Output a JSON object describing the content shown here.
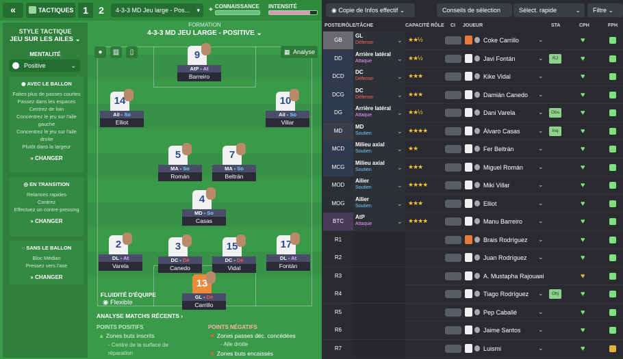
{
  "topbar": {
    "back": "«",
    "tab": "TACTIQUES",
    "n1": "1",
    "n2": "2",
    "formation": "4-3-3 MD Jeu large - Pos...",
    "connaissance": "CONNAISSANCE",
    "intensite": "INTENSITÉ",
    "plus": "+",
    "minus": "-"
  },
  "side": {
    "style_lbl": "STYLE TACTIQUE",
    "style": "JEU SUR LES AILES",
    "mentalite_lbl": "MENTALITÉ",
    "mentalite": "Positive",
    "ballon": {
      "title": "AVEC LE BALLON",
      "lines": [
        "Faites plus de passes courtes",
        "Passez dans les espaces",
        "Centrez de loin",
        "Concentrez le jeu sur l'aile gauche",
        "Concentrez le jeu sur l'aile droite",
        "Plutôt dans la largeur"
      ],
      "change": "CHANGER"
    },
    "transition": {
      "title": "EN TRANSITION",
      "lines": [
        "Relances rapides",
        "Contrez",
        "Effectuez un contre-pressing"
      ],
      "change": "CHANGER"
    },
    "sans": {
      "title": "SANS LE BALLON",
      "lines": [
        "Bloc Médian",
        "Pressez vers l'axe"
      ],
      "change": "CHANGER"
    }
  },
  "pitch": {
    "formation_lbl": "FORMATION",
    "formation": "4-3-3 MD JEU LARGE - POSITIVE",
    "analyse": "Analyse",
    "fluidite_lbl": "FLUIDITÉ D'ÉQUIPE",
    "fluidite": "Flexible",
    "analyse_matchs": "ANALYSE MATCHS RÉCENTS",
    "positifs_lbl": "POINTS POSITIFS",
    "positifs": [
      "Zones buts inscrits",
      "- Centre de la surface de réparation"
    ],
    "negatifs_lbl": "POINTS NÉGATIFS",
    "negatifs": [
      "Zones passes déc. concédées",
      "- Aile droite",
      "Zones buts encaissés"
    ],
    "players": [
      {
        "n": "9",
        "role": "AtP - ",
        "duty": "At",
        "dc": "a",
        "name": "Barreiro"
      },
      {
        "n": "14",
        "role": "AiI - ",
        "duty": "So",
        "dc": "s",
        "name": "Elliot"
      },
      {
        "n": "10",
        "role": "AiI - ",
        "duty": "So",
        "dc": "s",
        "name": "Villar"
      },
      {
        "n": "5",
        "role": "MA - ",
        "duty": "So",
        "dc": "s",
        "name": "Román"
      },
      {
        "n": "7",
        "role": "MA - ",
        "duty": "So",
        "dc": "s",
        "name": "Beltrán"
      },
      {
        "n": "4",
        "role": "MD - ",
        "duty": "So",
        "dc": "s",
        "name": "Casas"
      },
      {
        "n": "2",
        "role": "DL - ",
        "duty": "At",
        "dc": "a",
        "name": "Varela"
      },
      {
        "n": "3",
        "role": "DC - ",
        "duty": "Dé",
        "dc": "d",
        "name": "Canedo"
      },
      {
        "n": "15",
        "role": "DC - ",
        "duty": "Dé",
        "dc": "d",
        "name": "Vidal"
      },
      {
        "n": "17",
        "role": "DL - ",
        "duty": "At",
        "dc": "a",
        "name": "Fontán"
      },
      {
        "n": "13",
        "role": "GL - ",
        "duty": "Dé",
        "dc": "d",
        "name": "Carrillo"
      }
    ]
  },
  "right": {
    "copy": "Copie de Infos effectif",
    "conseils": "Conseils de sélection",
    "select": "Sélect. rapide",
    "filtre": "Filtre",
    "headers": [
      "POSTE/RÔLE/TÂCHE",
      "CAPACITÉ RÔLE",
      "CI",
      "JOUEUR",
      "STA",
      "CPH",
      "FPH"
    ],
    "rows": [
      {
        "pos": "GB",
        "role": "GL",
        "duty": "Défense",
        "stars": "★★½",
        "name": "Coke Carrillo",
        "sta": ""
      },
      {
        "pos": "DD",
        "role": "Arrière latéral",
        "duty": "Attaque",
        "stars": "★★½",
        "name": "Javi Fontán",
        "sta": "RJ"
      },
      {
        "pos": "DCD",
        "role": "DC",
        "duty": "Défense",
        "stars": "★★★",
        "name": "Kike Vidal",
        "sta": ""
      },
      {
        "pos": "DCG",
        "role": "DC",
        "duty": "Défense",
        "stars": "★★★",
        "name": "Damián Canedo",
        "sta": ""
      },
      {
        "pos": "DG",
        "role": "Arrière latéral",
        "duty": "Attaque",
        "stars": "★★½",
        "name": "Dani Varela",
        "sta": "Obs"
      },
      {
        "pos": "MD",
        "role": "MD",
        "duty": "Soutien",
        "stars": "★★★★",
        "name": "Álvaro Casas",
        "sta": "Inq"
      },
      {
        "pos": "MCD",
        "role": "Milieu axial",
        "duty": "Soutien",
        "stars": "★★",
        "name": "Fer Beltrán",
        "sta": ""
      },
      {
        "pos": "MCG",
        "role": "Milieu axial",
        "duty": "Soutien",
        "stars": "★★★",
        "name": "Miguel Román",
        "sta": ""
      },
      {
        "pos": "MOD",
        "role": "Ailier",
        "duty": "Soutien",
        "stars": "★★★★",
        "name": "Miki Villar",
        "sta": ""
      },
      {
        "pos": "MOG",
        "role": "Ailier",
        "duty": "Soutien",
        "stars": "★★★",
        "name": "Elliot",
        "sta": ""
      },
      {
        "pos": "BTC",
        "role": "AtP",
        "duty": "Attaque",
        "stars": "★★★★",
        "name": "Manu Barreiro",
        "sta": ""
      },
      {
        "pos": "R1",
        "role": "",
        "duty": "",
        "stars": "",
        "name": "Brais Rodríguez",
        "sta": ""
      },
      {
        "pos": "R2",
        "role": "",
        "duty": "",
        "stars": "",
        "name": "Juan Rodríguez",
        "sta": ""
      },
      {
        "pos": "R3",
        "role": "",
        "duty": "",
        "stars": "",
        "name": "A. Mustapha Rajouani",
        "sta": ""
      },
      {
        "pos": "R4",
        "role": "",
        "duty": "",
        "stars": "",
        "name": "Tiago Rodríguez",
        "sta": "Obj"
      },
      {
        "pos": "R5",
        "role": "",
        "duty": "",
        "stars": "",
        "name": "Pep Caballé",
        "sta": ""
      },
      {
        "pos": "R6",
        "role": "",
        "duty": "",
        "stars": "",
        "name": "Jaime Santos",
        "sta": ""
      },
      {
        "pos": "R7",
        "role": "",
        "duty": "",
        "stars": "",
        "name": "Luismi",
        "sta": ""
      }
    ]
  }
}
